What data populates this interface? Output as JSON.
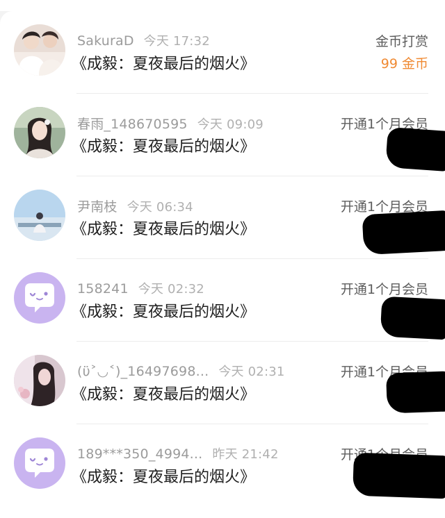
{
  "notifications": [
    {
      "username": "SakuraD",
      "time": "今天 17:32",
      "title": "《成毅：夏夜最后的烟火》",
      "action": "金币打赏",
      "reward": "99 金币",
      "avatar": "photo-man-avatar"
    },
    {
      "username": "春雨_148670595",
      "time": "今天 09:09",
      "title": "《成毅：夏夜最后的烟火》",
      "action": "开通1个月会员",
      "avatar": "photo-woman-avatar"
    },
    {
      "username": "尹南枝",
      "time": "今天 06:34",
      "title": "《成毅：夏夜最后的烟火》",
      "action": "开通1个月会员",
      "avatar": "photo-sky-avatar"
    },
    {
      "username": "158241",
      "time": "今天 02:32",
      "title": "《成毅：夏夜最后的烟火》",
      "action": "开通1个月会员",
      "avatar": "default-chat-avatar"
    },
    {
      "username": "(ϋ˃◡˂)_16497698...",
      "time": "今天 02:31",
      "title": "《成毅：夏夜最后的烟火》",
      "action": "开通1个月会员",
      "avatar": "photo-girl-avatar"
    },
    {
      "username": "189***350_4994...",
      "time": "昨天 21:42",
      "title": "《成毅：夏夜最后的烟火》",
      "action": "开通1个月会员",
      "avatar": "default-chat-avatar"
    }
  ],
  "colors": {
    "reward": "#f08a33",
    "default_avatar": "#c9b4f0"
  }
}
